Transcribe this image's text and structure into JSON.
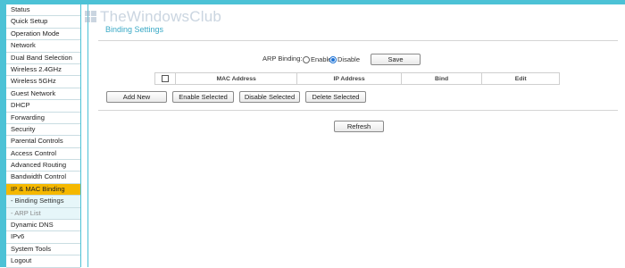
{
  "menu": [
    {
      "label": "Status",
      "type": "item"
    },
    {
      "label": "Quick Setup",
      "type": "item"
    },
    {
      "label": "Operation Mode",
      "type": "item"
    },
    {
      "label": "Network",
      "type": "item"
    },
    {
      "label": "Dual Band Selection",
      "type": "item"
    },
    {
      "label": "Wireless 2.4GHz",
      "type": "item"
    },
    {
      "label": "Wireless 5GHz",
      "type": "item"
    },
    {
      "label": "Guest Network",
      "type": "item"
    },
    {
      "label": "DHCP",
      "type": "item"
    },
    {
      "label": "Forwarding",
      "type": "item"
    },
    {
      "label": "Security",
      "type": "item"
    },
    {
      "label": "Parental Controls",
      "type": "item"
    },
    {
      "label": "Access Control",
      "type": "item"
    },
    {
      "label": "Advanced Routing",
      "type": "item"
    },
    {
      "label": "Bandwidth Control",
      "type": "item"
    },
    {
      "label": "IP & MAC Binding",
      "type": "active"
    },
    {
      "label": "- Binding Settings",
      "type": "sub-selected"
    },
    {
      "label": "- ARP List",
      "type": "sub"
    },
    {
      "label": "Dynamic DNS",
      "type": "item"
    },
    {
      "label": "IPv6",
      "type": "item"
    },
    {
      "label": "System Tools",
      "type": "item"
    },
    {
      "label": "Logout",
      "type": "item"
    }
  ],
  "watermark": "TheWindowsClub",
  "page_title": "Binding Settings",
  "arp": {
    "label": "ARP Binding:",
    "enable_label": "Enable",
    "disable_label": "Disable",
    "selected": "Disable",
    "save_label": "Save"
  },
  "table": {
    "columns": [
      "MAC Address",
      "IP Address",
      "Bind",
      "Edit"
    ]
  },
  "actions": {
    "add_new": "Add New",
    "enable_selected": "Enable Selected",
    "disable_selected": "Disable Selected",
    "delete_selected": "Delete Selected"
  },
  "refresh_label": "Refresh",
  "colors": {
    "accent": "#4cc2d6",
    "active_menu": "#f5b800",
    "title": "#3aa9c6"
  }
}
